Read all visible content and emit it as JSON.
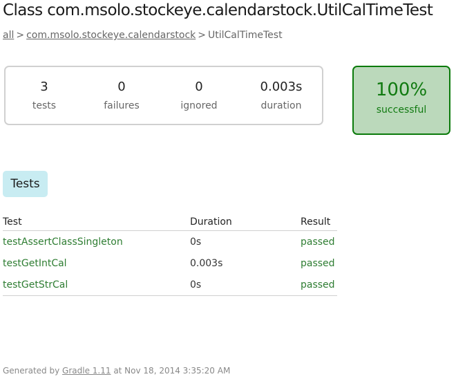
{
  "header": {
    "title": "Class com.msolo.stockeye.calendarstock.UtilCalTimeTest"
  },
  "breadcrumb": {
    "root": "all",
    "separator": ">",
    "package": "com.msolo.stockeye.calendarstock",
    "current": "UtilCalTimeTest"
  },
  "summary": {
    "tests": {
      "value": "3",
      "label": "tests"
    },
    "failures": {
      "value": "0",
      "label": "failures"
    },
    "ignored": {
      "value": "0",
      "label": "ignored"
    },
    "duration": {
      "value": "0.003s",
      "label": "duration"
    },
    "success_rate": {
      "value": "100%",
      "label": "successful"
    }
  },
  "tabs": {
    "tests_label": "Tests"
  },
  "table": {
    "headers": {
      "test": "Test",
      "duration": "Duration",
      "result": "Result"
    },
    "rows": [
      {
        "test": "testAssertClassSingleton",
        "duration": "0s",
        "result": "passed"
      },
      {
        "test": "testGetIntCal",
        "duration": "0.003s",
        "result": "passed"
      },
      {
        "test": "testGetStrCal",
        "duration": "0s",
        "result": "passed"
      }
    ]
  },
  "footer": {
    "prefix": "Generated by",
    "tool": "Gradle 1.11",
    "suffix": "at Nov 18, 2014 3:35:20 AM"
  },
  "colors": {
    "success_text": "#117a11",
    "success_bg": "#bbd9bb",
    "success_border": "#0a7a0a",
    "tab_bg": "#c8ecf2",
    "passed_text": "#2e7d32"
  }
}
